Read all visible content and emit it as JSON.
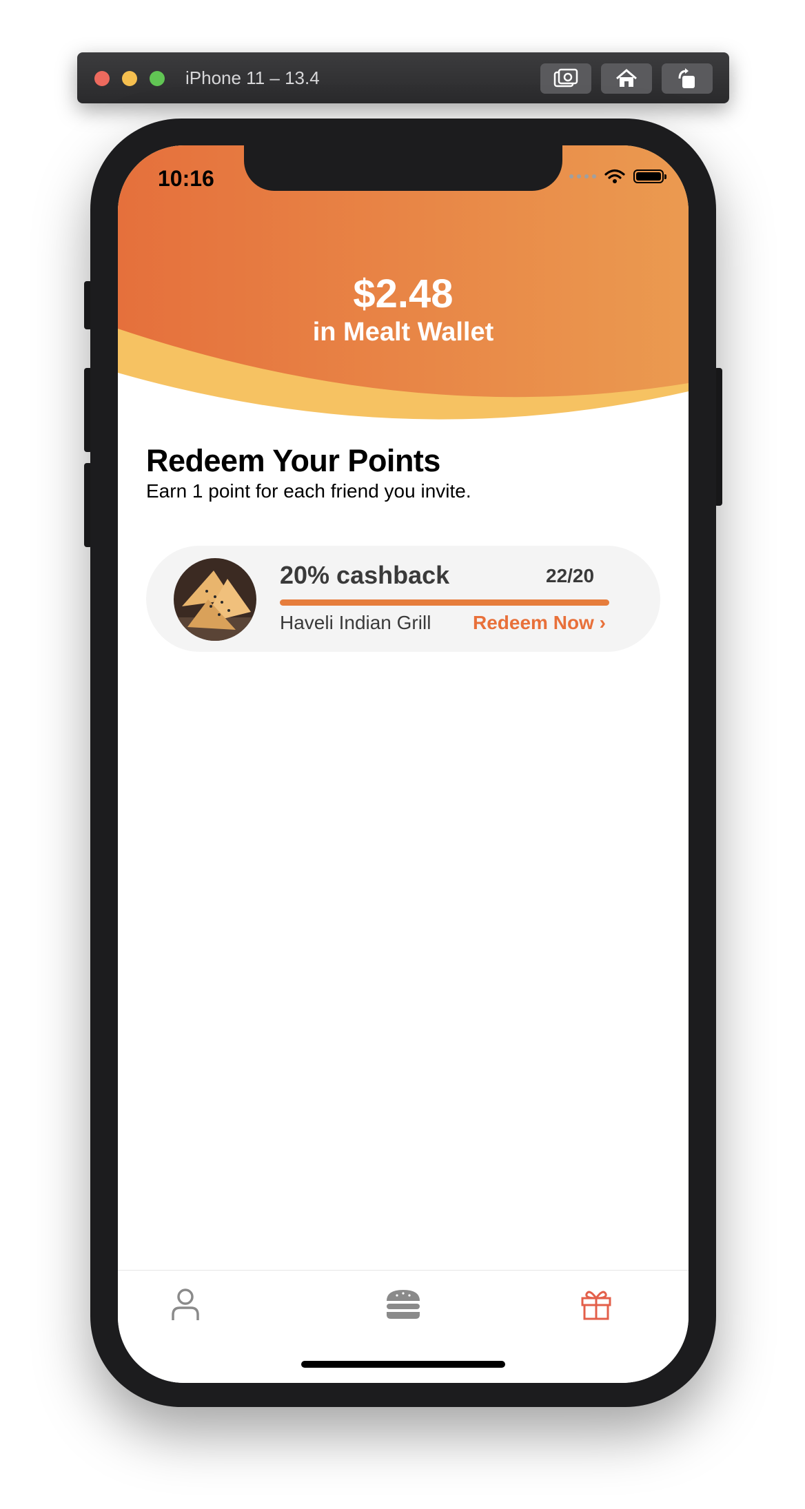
{
  "simulator": {
    "title": "iPhone 11 – 13.4",
    "buttons": [
      "screenshot-icon",
      "home-icon",
      "rotate-icon"
    ]
  },
  "status_bar": {
    "time": "10:16"
  },
  "wallet": {
    "amount": "$2.48",
    "label": "in Mealt Wallet"
  },
  "colors": {
    "header_orange_start": "#e5703c",
    "header_orange_end": "#eb9a50",
    "header_yellow": "#f6c262",
    "accent": "#e8703a",
    "gift_active": "#e35f4a"
  },
  "redeem_section": {
    "title": "Redeem Your Points",
    "subtitle": "Earn 1 point for each friend you invite."
  },
  "rewards": [
    {
      "offer": "20% cashback",
      "progress_text": "22/20",
      "progress_fraction": 1.0,
      "restaurant": "Haveli Indian Grill",
      "action": "Redeem Now ›"
    }
  ],
  "tab_bar": {
    "tabs": [
      {
        "icon": "person-icon",
        "active": false
      },
      {
        "icon": "burger-icon",
        "active": false
      },
      {
        "icon": "gift-icon",
        "active": true
      }
    ]
  }
}
